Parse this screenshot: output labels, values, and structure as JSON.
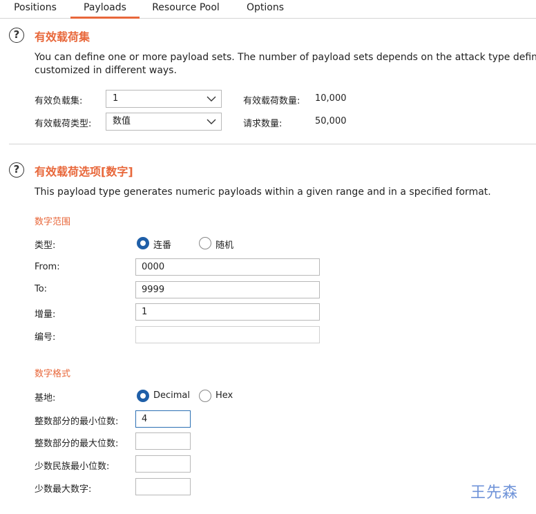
{
  "tabs": [
    "Positions",
    "Payloads",
    "Resource Pool",
    "Options"
  ],
  "active_tab": "Payloads",
  "sets": {
    "title": "有效载荷集",
    "desc_line1": "You can define one or more payload sets. The number of payload sets depends on the attack type defined in",
    "desc_line2": "customized in different ways.",
    "payload_set_label": "有效负载集:",
    "payload_set_value": "1",
    "payload_type_label": "有效载荷类型:",
    "payload_type_value": "数值",
    "payload_count_label": "有效载荷数量:",
    "payload_count_value": "10,000",
    "request_count_label": "请求数量:",
    "request_count_value": "50,000"
  },
  "options": {
    "title": "有效载荷选项[数字]",
    "desc": "This payload type generates numeric payloads within a given range and in a specified format.",
    "range": {
      "heading": "数字范围",
      "type_label": "类型:",
      "type_sequential": "连番",
      "type_random": "随机",
      "type_selected": "sequential",
      "from_label": "From:",
      "from_value": "0000",
      "to_label": "To:",
      "to_value": "9999",
      "step_label": "增量:",
      "step_value": "1",
      "howmany_label": "编号:",
      "howmany_value": ""
    },
    "format": {
      "heading": "数字格式",
      "base_label": "基地:",
      "base_decimal": "Decimal",
      "base_hex": "Hex",
      "base_selected": "decimal",
      "min_int_label": "整数部分的最小位数:",
      "min_int_value": "4",
      "max_int_label": "整数部分的最大位数:",
      "max_int_value": "",
      "min_frac_label": "少数民族最小位数:",
      "min_frac_value": "",
      "max_frac_label": "少数最大数字:",
      "max_frac_value": ""
    }
  },
  "watermark": "王先森",
  "colors": {
    "accent": "#e8673a",
    "radio": "#1f5fa8",
    "watermark": "#6f93d8"
  }
}
